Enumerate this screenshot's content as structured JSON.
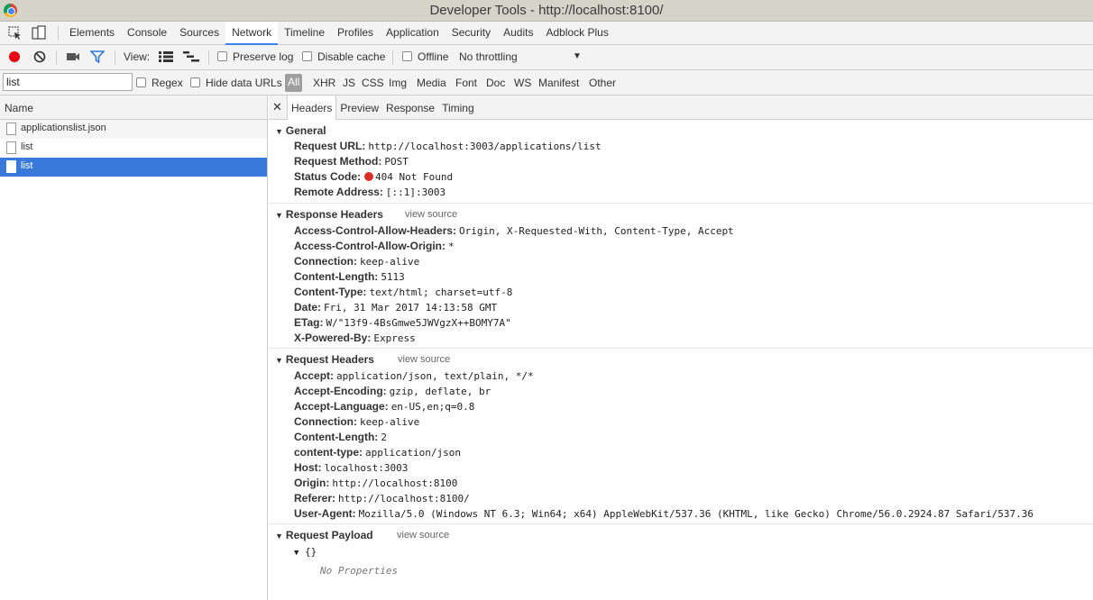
{
  "window": {
    "title": "Developer Tools - http://localhost:8100/"
  },
  "tabs": [
    "Elements",
    "Console",
    "Sources",
    "Network",
    "Timeline",
    "Profiles",
    "Application",
    "Security",
    "Audits",
    "Adblock Plus"
  ],
  "active_tab": "Network",
  "toolbar": {
    "view_label": "View:",
    "preserve_log": "Preserve log",
    "disable_cache": "Disable cache",
    "offline": "Offline",
    "throttling": "No throttling"
  },
  "filter": {
    "value": "list",
    "regex": "Regex",
    "hide_data_urls": "Hide data URLs",
    "types": [
      "All",
      "XHR",
      "JS",
      "CSS",
      "Img",
      "Media",
      "Font",
      "Doc",
      "WS",
      "Manifest",
      "Other"
    ]
  },
  "requests": {
    "header": "Name",
    "items": [
      "applicationslist.json",
      "list",
      "list"
    ]
  },
  "detail_tabs": [
    "Headers",
    "Preview",
    "Response",
    "Timing"
  ],
  "general": {
    "title": "General",
    "rows": [
      {
        "k": "Request URL:",
        "v": "http://localhost:3003/applications/list"
      },
      {
        "k": "Request Method:",
        "v": "POST"
      },
      {
        "k": "Status Code:",
        "v": "404 Not Found"
      },
      {
        "k": "Remote Address:",
        "v": "[::1]:3003"
      }
    ]
  },
  "response_headers": {
    "title": "Response Headers",
    "view_source": "view source",
    "rows": [
      {
        "k": "Access-Control-Allow-Headers:",
        "v": "Origin, X-Requested-With, Content-Type, Accept"
      },
      {
        "k": "Access-Control-Allow-Origin:",
        "v": "*"
      },
      {
        "k": "Connection:",
        "v": "keep-alive"
      },
      {
        "k": "Content-Length:",
        "v": "5113"
      },
      {
        "k": "Content-Type:",
        "v": "text/html; charset=utf-8"
      },
      {
        "k": "Date:",
        "v": "Fri, 31 Mar 2017 14:13:58 GMT"
      },
      {
        "k": "ETag:",
        "v": "W/\"13f9-4BsGmwe5JWVgzX++BOMY7A\""
      },
      {
        "k": "X-Powered-By:",
        "v": "Express"
      }
    ]
  },
  "request_headers": {
    "title": "Request Headers",
    "view_source": "view source",
    "rows": [
      {
        "k": "Accept:",
        "v": "application/json, text/plain, */*"
      },
      {
        "k": "Accept-Encoding:",
        "v": "gzip, deflate, br"
      },
      {
        "k": "Accept-Language:",
        "v": "en-US,en;q=0.8"
      },
      {
        "k": "Connection:",
        "v": "keep-alive"
      },
      {
        "k": "Content-Length:",
        "v": "2"
      },
      {
        "k": "content-type:",
        "v": "application/json"
      },
      {
        "k": "Host:",
        "v": "localhost:3003"
      },
      {
        "k": "Origin:",
        "v": "http://localhost:8100"
      },
      {
        "k": "Referer:",
        "v": "http://localhost:8100/"
      },
      {
        "k": "User-Agent:",
        "v": "Mozilla/5.0 (Windows NT 6.3; Win64; x64) AppleWebKit/537.36 (KHTML, like Gecko) Chrome/56.0.2924.87 Safari/537.36"
      }
    ]
  },
  "request_payload": {
    "title": "Request Payload",
    "view_source": "view source",
    "object": "{}",
    "empty": "No Properties"
  },
  "colors": {
    "selected_row": "#3879d9",
    "active_tab_underline": "#3e82f7",
    "record": "#e8000d"
  }
}
